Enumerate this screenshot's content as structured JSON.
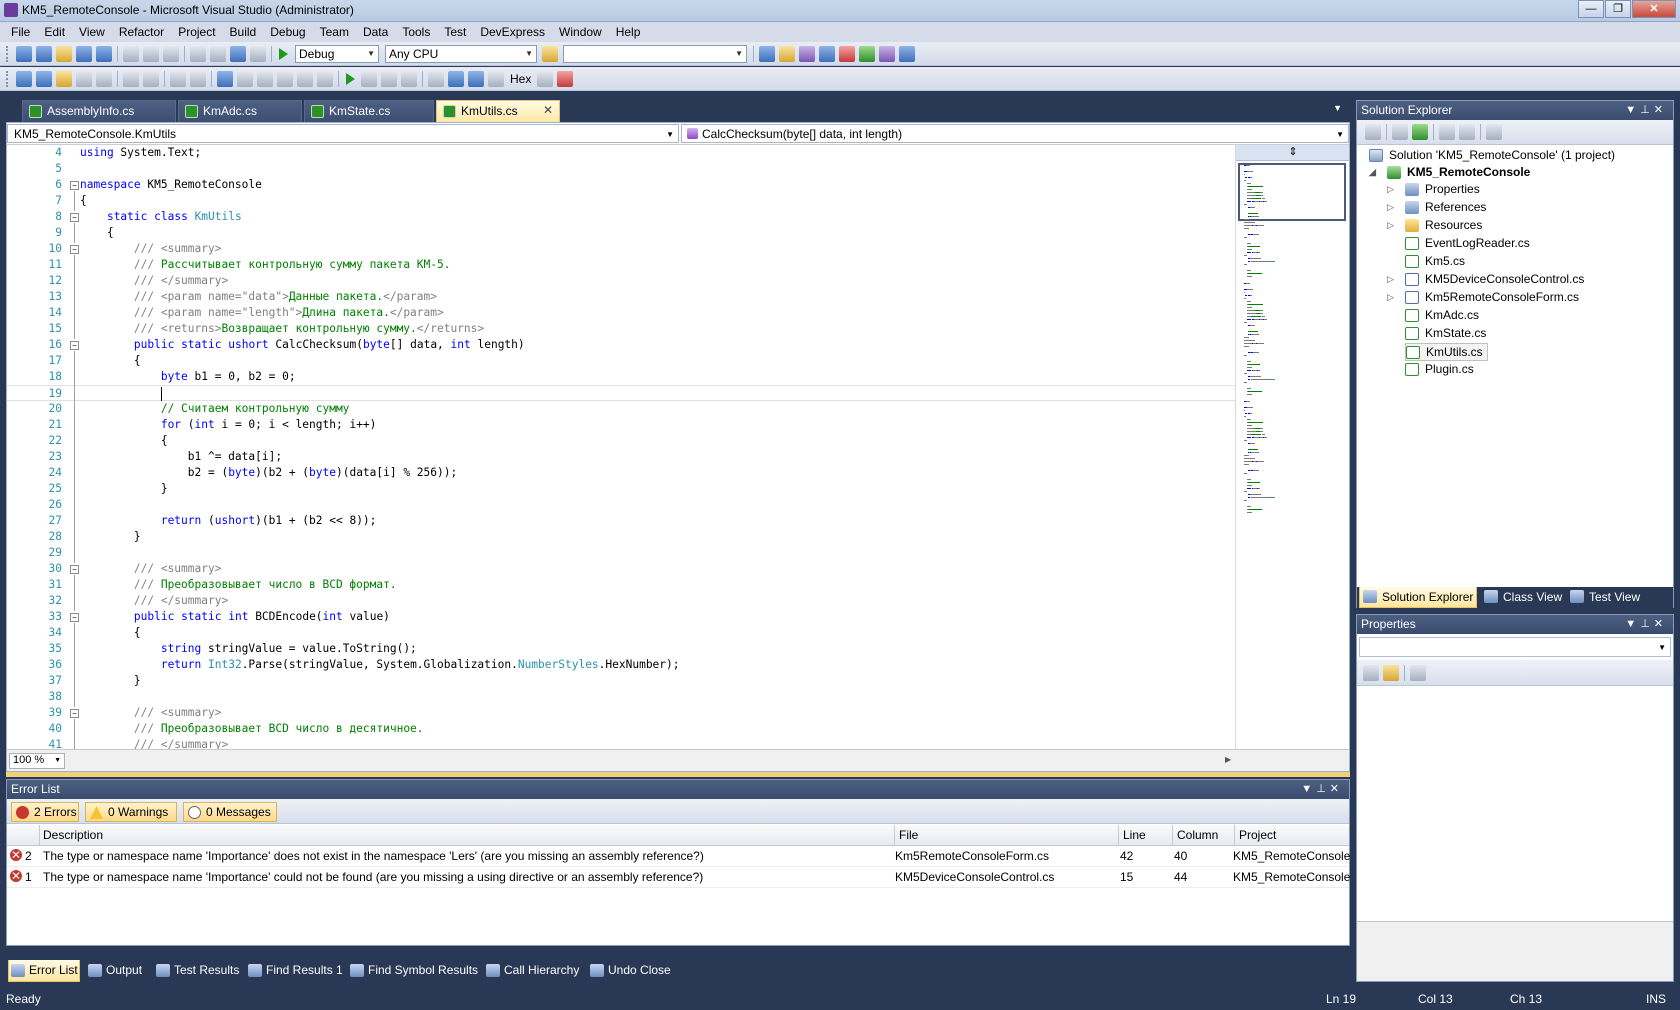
{
  "window": {
    "title": "KM5_RemoteConsole - Microsoft Visual Studio (Administrator)"
  },
  "menu": [
    "File",
    "Edit",
    "View",
    "Refactor",
    "Project",
    "Build",
    "Debug",
    "Team",
    "Data",
    "Tools",
    "Test",
    "DevExpress",
    "Window",
    "Help"
  ],
  "toolbar": {
    "configuration": "Debug",
    "platform": "Any CPU",
    "find_value": "",
    "hex_label": "Hex"
  },
  "tabs": [
    {
      "label": "AssemblyInfo.cs",
      "active": false
    },
    {
      "label": "KmAdc.cs",
      "active": false
    },
    {
      "label": "KmState.cs",
      "active": false
    },
    {
      "label": "KmUtils.cs",
      "active": true
    }
  ],
  "editor": {
    "type_nav": "KM5_RemoteConsole.KmUtils",
    "member_nav": "CalcChecksum(byte[] data, int length)",
    "zoom": "100 %",
    "current_line": 19,
    "lines": [
      {
        "n": "4",
        "fold": "",
        "segments": [
          {
            "t": "using",
            "c": "kw"
          },
          {
            "t": " System.Text;",
            "c": ""
          }
        ]
      },
      {
        "n": "5",
        "fold": "",
        "segments": []
      },
      {
        "n": "6",
        "fold": "−",
        "segments": [
          {
            "t": "namespace",
            "c": "kw"
          },
          {
            "t": " KM5_RemoteConsole",
            "c": ""
          }
        ]
      },
      {
        "n": "7",
        "fold": "",
        "segments": [
          {
            "t": "{",
            "c": ""
          }
        ]
      },
      {
        "n": "8",
        "fold": "−",
        "segments": [
          {
            "t": "    ",
            "c": ""
          },
          {
            "t": "static",
            "c": "kw"
          },
          {
            "t": " ",
            "c": ""
          },
          {
            "t": "class",
            "c": "kw"
          },
          {
            "t": " ",
            "c": ""
          },
          {
            "t": "KmUtils",
            "c": "ty"
          }
        ]
      },
      {
        "n": "9",
        "fold": "",
        "segments": [
          {
            "t": "    {",
            "c": ""
          }
        ]
      },
      {
        "n": "10",
        "fold": "−",
        "segments": [
          {
            "t": "        ",
            "c": ""
          },
          {
            "t": "/// <summary>",
            "c": "doc"
          }
        ]
      },
      {
        "n": "11",
        "fold": "",
        "segments": [
          {
            "t": "        ",
            "c": ""
          },
          {
            "t": "/// ",
            "c": "doc"
          },
          {
            "t": "Рассчитывает контрольную сумму пакета КМ-5.",
            "c": "cm"
          }
        ]
      },
      {
        "n": "12",
        "fold": "",
        "segments": [
          {
            "t": "        ",
            "c": ""
          },
          {
            "t": "/// </summary>",
            "c": "doc"
          }
        ]
      },
      {
        "n": "13",
        "fold": "",
        "segments": [
          {
            "t": "        ",
            "c": ""
          },
          {
            "t": "/// <param name=\"data\">",
            "c": "doc"
          },
          {
            "t": "Данные пакета.",
            "c": "cm"
          },
          {
            "t": "</param>",
            "c": "doc"
          }
        ]
      },
      {
        "n": "14",
        "fold": "",
        "segments": [
          {
            "t": "        ",
            "c": ""
          },
          {
            "t": "/// <param name=\"length\">",
            "c": "doc"
          },
          {
            "t": "Длина пакета.",
            "c": "cm"
          },
          {
            "t": "</param>",
            "c": "doc"
          }
        ]
      },
      {
        "n": "15",
        "fold": "",
        "segments": [
          {
            "t": "        ",
            "c": ""
          },
          {
            "t": "/// <returns>",
            "c": "doc"
          },
          {
            "t": "Возвращает контрольную сумму.",
            "c": "cm"
          },
          {
            "t": "</returns>",
            "c": "doc"
          }
        ]
      },
      {
        "n": "16",
        "fold": "−",
        "segments": [
          {
            "t": "        ",
            "c": ""
          },
          {
            "t": "public",
            "c": "kw"
          },
          {
            "t": " ",
            "c": ""
          },
          {
            "t": "static",
            "c": "kw"
          },
          {
            "t": " ",
            "c": ""
          },
          {
            "t": "ushort",
            "c": "kw"
          },
          {
            "t": " CalcChecksum(",
            "c": ""
          },
          {
            "t": "byte",
            "c": "kw"
          },
          {
            "t": "[] data, ",
            "c": ""
          },
          {
            "t": "int",
            "c": "kw"
          },
          {
            "t": " length)",
            "c": ""
          }
        ]
      },
      {
        "n": "17",
        "fold": "",
        "segments": [
          {
            "t": "        {",
            "c": ""
          }
        ]
      },
      {
        "n": "18",
        "fold": "",
        "segments": [
          {
            "t": "            ",
            "c": ""
          },
          {
            "t": "byte",
            "c": "kw"
          },
          {
            "t": " b1 = 0, b2 = 0;",
            "c": ""
          }
        ]
      },
      {
        "n": "19",
        "fold": "",
        "segments": [
          {
            "t": "            ",
            "c": ""
          }
        ]
      },
      {
        "n": "20",
        "fold": "",
        "segments": [
          {
            "t": "            ",
            "c": ""
          },
          {
            "t": "// Считаем контрольную сумму",
            "c": "cm"
          }
        ]
      },
      {
        "n": "21",
        "fold": "",
        "segments": [
          {
            "t": "            ",
            "c": ""
          },
          {
            "t": "for",
            "c": "kw"
          },
          {
            "t": " (",
            "c": ""
          },
          {
            "t": "int",
            "c": "kw"
          },
          {
            "t": " i = 0; i < length; i++)",
            "c": ""
          }
        ]
      },
      {
        "n": "22",
        "fold": "",
        "segments": [
          {
            "t": "            {",
            "c": ""
          }
        ]
      },
      {
        "n": "23",
        "fold": "",
        "segments": [
          {
            "t": "                b1 ^= data[i];",
            "c": ""
          }
        ]
      },
      {
        "n": "24",
        "fold": "",
        "segments": [
          {
            "t": "                b2 = (",
            "c": ""
          },
          {
            "t": "byte",
            "c": "kw"
          },
          {
            "t": ")(b2 + (",
            "c": ""
          },
          {
            "t": "byte",
            "c": "kw"
          },
          {
            "t": ")(data[i] % 256));",
            "c": ""
          }
        ]
      },
      {
        "n": "25",
        "fold": "",
        "segments": [
          {
            "t": "            }",
            "c": ""
          }
        ]
      },
      {
        "n": "26",
        "fold": "",
        "segments": []
      },
      {
        "n": "27",
        "fold": "",
        "segments": [
          {
            "t": "            ",
            "c": ""
          },
          {
            "t": "return",
            "c": "kw"
          },
          {
            "t": " (",
            "c": ""
          },
          {
            "t": "ushort",
            "c": "kw"
          },
          {
            "t": ")(b1 + (b2 << 8));",
            "c": ""
          }
        ]
      },
      {
        "n": "28",
        "fold": "",
        "segments": [
          {
            "t": "        }",
            "c": ""
          }
        ]
      },
      {
        "n": "29",
        "fold": "",
        "segments": []
      },
      {
        "n": "30",
        "fold": "−",
        "segments": [
          {
            "t": "        ",
            "c": ""
          },
          {
            "t": "/// <summary>",
            "c": "doc"
          }
        ]
      },
      {
        "n": "31",
        "fold": "",
        "segments": [
          {
            "t": "        ",
            "c": ""
          },
          {
            "t": "/// ",
            "c": "doc"
          },
          {
            "t": "Преобразовывает число в BCD формат.",
            "c": "cm"
          }
        ]
      },
      {
        "n": "32",
        "fold": "",
        "segments": [
          {
            "t": "        ",
            "c": ""
          },
          {
            "t": "/// </summary>",
            "c": "doc"
          }
        ]
      },
      {
        "n": "33",
        "fold": "−",
        "segments": [
          {
            "t": "        ",
            "c": ""
          },
          {
            "t": "public",
            "c": "kw"
          },
          {
            "t": " ",
            "c": ""
          },
          {
            "t": "static",
            "c": "kw"
          },
          {
            "t": " ",
            "c": ""
          },
          {
            "t": "int",
            "c": "kw"
          },
          {
            "t": " BCDEncode(",
            "c": ""
          },
          {
            "t": "int",
            "c": "kw"
          },
          {
            "t": " value)",
            "c": ""
          }
        ]
      },
      {
        "n": "34",
        "fold": "",
        "segments": [
          {
            "t": "        {",
            "c": ""
          }
        ]
      },
      {
        "n": "35",
        "fold": "",
        "segments": [
          {
            "t": "            ",
            "c": ""
          },
          {
            "t": "string",
            "c": "kw"
          },
          {
            "t": " stringValue = value.ToString();",
            "c": ""
          }
        ]
      },
      {
        "n": "36",
        "fold": "",
        "segments": [
          {
            "t": "            ",
            "c": ""
          },
          {
            "t": "return",
            "c": "kw"
          },
          {
            "t": " ",
            "c": ""
          },
          {
            "t": "Int32",
            "c": "ty"
          },
          {
            "t": ".Parse(stringValue, System.Globalization.",
            "c": ""
          },
          {
            "t": "NumberStyles",
            "c": "ty"
          },
          {
            "t": ".HexNumber);",
            "c": ""
          }
        ]
      },
      {
        "n": "37",
        "fold": "",
        "segments": [
          {
            "t": "        }",
            "c": ""
          }
        ]
      },
      {
        "n": "38",
        "fold": "",
        "segments": []
      },
      {
        "n": "39",
        "fold": "−",
        "segments": [
          {
            "t": "        ",
            "c": ""
          },
          {
            "t": "/// <summary>",
            "c": "doc"
          }
        ]
      },
      {
        "n": "40",
        "fold": "",
        "segments": [
          {
            "t": "        ",
            "c": ""
          },
          {
            "t": "/// ",
            "c": "doc"
          },
          {
            "t": "Преобразовывает BCD число в десятичное.",
            "c": "cm"
          }
        ]
      },
      {
        "n": "41",
        "fold": "",
        "segments": [
          {
            "t": "        ",
            "c": ""
          },
          {
            "t": "/// </summary>",
            "c": "doc"
          }
        ]
      }
    ]
  },
  "error_list": {
    "title": "Error List",
    "filters": {
      "errors": "2 Errors",
      "warnings": "0 Warnings",
      "messages": "0 Messages"
    },
    "columns": {
      "description": "Description",
      "file": "File",
      "line": "Line",
      "column": "Column",
      "project": "Project"
    },
    "rows": [
      {
        "num": "2",
        "description": "The type or namespace name 'Importance' does not exist in the namespace 'Lers' (are you missing an assembly reference?)",
        "file": "Km5RemoteConsoleForm.cs",
        "line": "42",
        "column": "40",
        "project": "KM5_RemoteConsole"
      },
      {
        "num": "1",
        "description": "The type or namespace name 'Importance' could not be found (are you missing a using directive or an assembly reference?)",
        "file": "KM5DeviceConsoleControl.cs",
        "line": "15",
        "column": "44",
        "project": "KM5_RemoteConsole"
      }
    ]
  },
  "bottom_tabs": [
    "Error List",
    "Output",
    "Test Results",
    "Find Results 1",
    "Find Symbol Results",
    "Call Hierarchy",
    "Undo Close"
  ],
  "solution_explorer": {
    "title": "Solution Explorer",
    "items": [
      {
        "label": "Solution 'KM5_RemoteConsole' (1 project)",
        "icon": "solution-icon"
      },
      {
        "label": "KM5_RemoteConsole",
        "icon": "project-icon"
      },
      {
        "label": "Properties",
        "icon": "properties-icon"
      },
      {
        "label": "References",
        "icon": "references-icon"
      },
      {
        "label": "Resources",
        "icon": "folder-icon"
      },
      {
        "label": "EventLogReader.cs",
        "icon": "cs-file-icon"
      },
      {
        "label": "Km5.cs",
        "icon": "cs-file-icon"
      },
      {
        "label": "KM5DeviceConsoleControl.cs",
        "icon": "form-file-icon"
      },
      {
        "label": "Km5RemoteConsoleForm.cs",
        "icon": "form-file-icon"
      },
      {
        "label": "KmAdc.cs",
        "icon": "cs-file-icon"
      },
      {
        "label": "KmState.cs",
        "icon": "cs-file-icon"
      },
      {
        "label": "KmUtils.cs",
        "icon": "cs-file-icon"
      },
      {
        "label": "Plugin.cs",
        "icon": "cs-file-icon"
      }
    ],
    "tabs": [
      "Solution Explorer",
      "Class View",
      "Test View"
    ]
  },
  "properties": {
    "title": "Properties"
  },
  "status": {
    "text": "Ready",
    "ln": "Ln 19",
    "col": "Col 13",
    "ch": "Ch 13",
    "mode": "INS"
  },
  "colors": {
    "chrome": "#293955",
    "accent_tab": "#ffe8a6",
    "keyword": "#0000ff",
    "comment": "#008000",
    "type": "#2b91af",
    "error": "#c8372d"
  }
}
